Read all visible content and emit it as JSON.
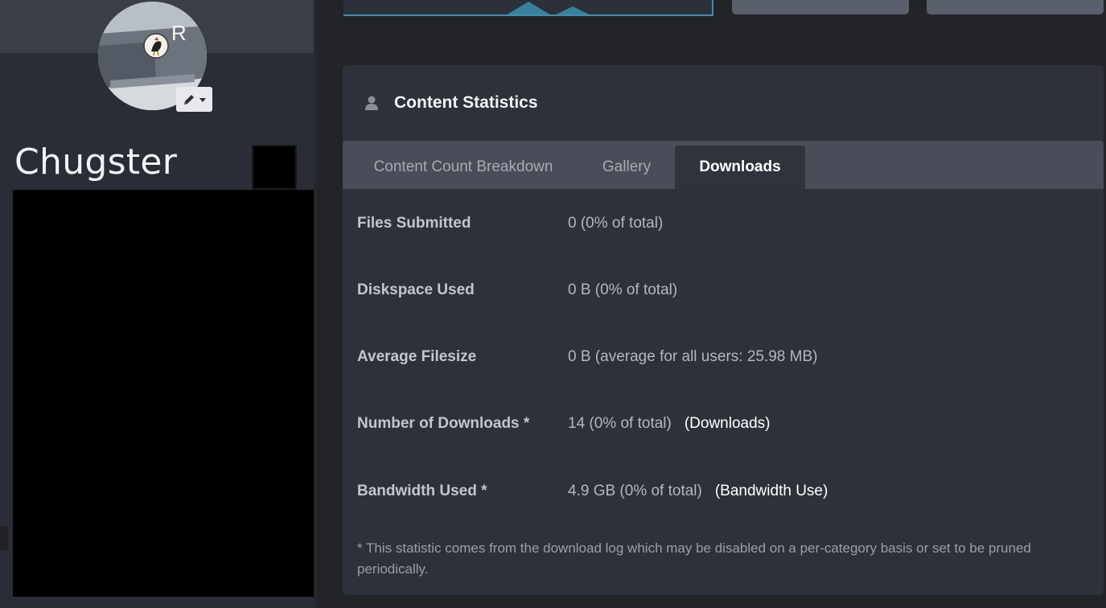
{
  "profile": {
    "username": "Chugster",
    "avatar_badge_letter": "R"
  },
  "panel": {
    "title": "Content Statistics",
    "tabs": [
      {
        "label": "Content Count Breakdown",
        "active": false
      },
      {
        "label": "Gallery",
        "active": false
      },
      {
        "label": "Downloads",
        "active": true
      }
    ]
  },
  "stats": [
    {
      "label": "Files Submitted",
      "value": "0 (0% of total)",
      "link": ""
    },
    {
      "label": "Diskspace Used",
      "value": "0 B (0% of total)",
      "link": ""
    },
    {
      "label": "Average Filesize",
      "value": "0 B (average for all users: 25.98 MB)",
      "link": ""
    },
    {
      "label": "Number of Downloads *",
      "value": "14 (0% of total)",
      "link": "(Downloads)"
    },
    {
      "label": "Bandwidth Used *",
      "value": "4.9 GB (0% of total)",
      "link": "(Bandwidth Use)"
    }
  ],
  "footnote": "* This statistic comes from the download log which may be disabled on a per-category basis or set to be pruned periodically.",
  "icons": {
    "header": "user-icon",
    "avatar_edit": "pencil-icon",
    "avatar_edit_menu": "caret-down-icon"
  },
  "colors": {
    "background": "#222428",
    "panel": "#2e3139",
    "tabs_bar": "#494d58",
    "chart_accent": "#3b8fb0"
  }
}
